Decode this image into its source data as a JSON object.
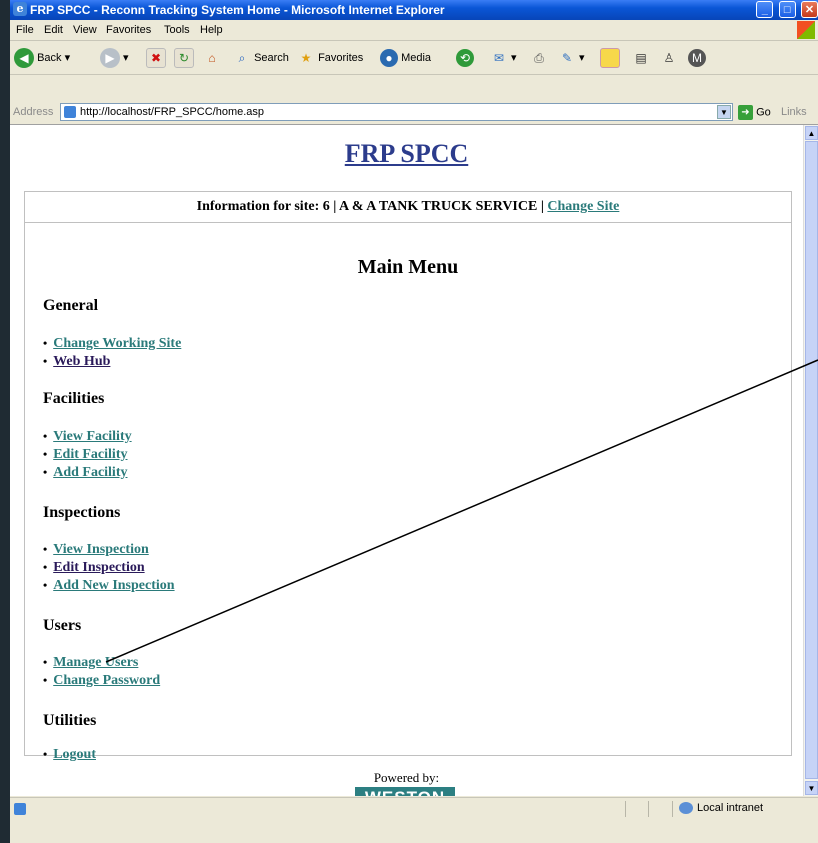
{
  "window": {
    "title": "FRP SPCC - Reconn Tracking System Home - Microsoft Internet Explorer",
    "minimize": "_",
    "maximize": "□",
    "close": "✕"
  },
  "menubar": [
    "File",
    "Edit",
    "View",
    "Favorites",
    "Tools",
    "Help"
  ],
  "toolbar": {
    "back": "Back",
    "search": "Search",
    "favorites": "Favorites",
    "media": "Media"
  },
  "address": {
    "label": "Address",
    "url": "http://localhost/FRP_SPCC/home.asp",
    "go": "Go",
    "links": "Links"
  },
  "page": {
    "heading": "FRP SPCC",
    "site_info_prefix": "Information for site: 6 | A & A TANK TRUCK SERVICE |",
    "change_site": "Change Site",
    "main_menu": "Main Menu",
    "sections": [
      {
        "title": "General",
        "items": [
          "Change Working Site",
          "Web Hub"
        ]
      },
      {
        "title": "Facilities",
        "items": [
          "View Facility",
          "Edit Facility",
          "Add Facility"
        ]
      },
      {
        "title": "Inspections",
        "items": [
          "View Inspection",
          "Edit Inspection",
          "Add New Inspection"
        ]
      },
      {
        "title": "Users",
        "items": [
          "Manage Users",
          "Change Password"
        ]
      },
      {
        "title": "Utilities",
        "items": [
          "Logout"
        ]
      }
    ],
    "powered_by": "Powered by:",
    "weston_logo": "WESTON"
  },
  "status": {
    "zone": "Local intranet"
  },
  "colors": {
    "link": "#2a7a7a",
    "visited_link": "#2a1a5a",
    "heading": "#2c3c8c",
    "titlebar": "#0a56d6"
  }
}
